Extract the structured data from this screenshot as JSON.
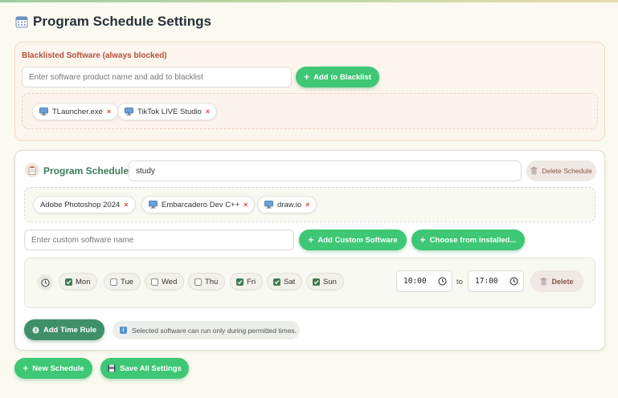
{
  "page": {
    "title": "Program Schedule Settings"
  },
  "blacklist": {
    "heading": "Blacklisted Software (always blocked)",
    "input_placeholder": "Enter software product name and add to blacklist",
    "add_label": "Add to Blacklist",
    "items": [
      {
        "name": "TLauncher.exe",
        "remove": "×"
      },
      {
        "name": "TikTok LIVE Studio",
        "remove": "×"
      }
    ]
  },
  "schedule": {
    "label": "Program Schedule",
    "name_value": "study",
    "delete_label": "Delete Schedule",
    "software": [
      {
        "name": "Adobe Photoshop 2024",
        "remove": "×"
      },
      {
        "name": "Embarcadero Dev C++",
        "remove": "×"
      },
      {
        "name": "draw.io",
        "remove": "×"
      }
    ],
    "custom_placeholder": "Enter custom software name",
    "add_custom_label": "Add Custom Software",
    "choose_label": "Choose from installed...",
    "time_rule": {
      "days": [
        {
          "label": "Mon",
          "checked": true
        },
        {
          "label": "Tue",
          "checked": false
        },
        {
          "label": "Wed",
          "checked": false
        },
        {
          "label": "Thu",
          "checked": false
        },
        {
          "label": "Fri",
          "checked": true
        },
        {
          "label": "Sat",
          "checked": true
        },
        {
          "label": "Sun",
          "checked": true
        }
      ],
      "start": "10:00",
      "to": "to",
      "end": "17:00",
      "delete_label": "Delete"
    },
    "add_time_rule_label": "Add Time Rule",
    "info_text": "Selected software can run only during permitted times."
  },
  "footer": {
    "new_schedule_label": "New Schedule",
    "save_label": "Save All Settings"
  },
  "colors": {
    "accent_green": "#3ec774",
    "dark_green": "#3f8f68",
    "blacklist_heading": "#b5503a",
    "remove_x": "#d0463e"
  }
}
